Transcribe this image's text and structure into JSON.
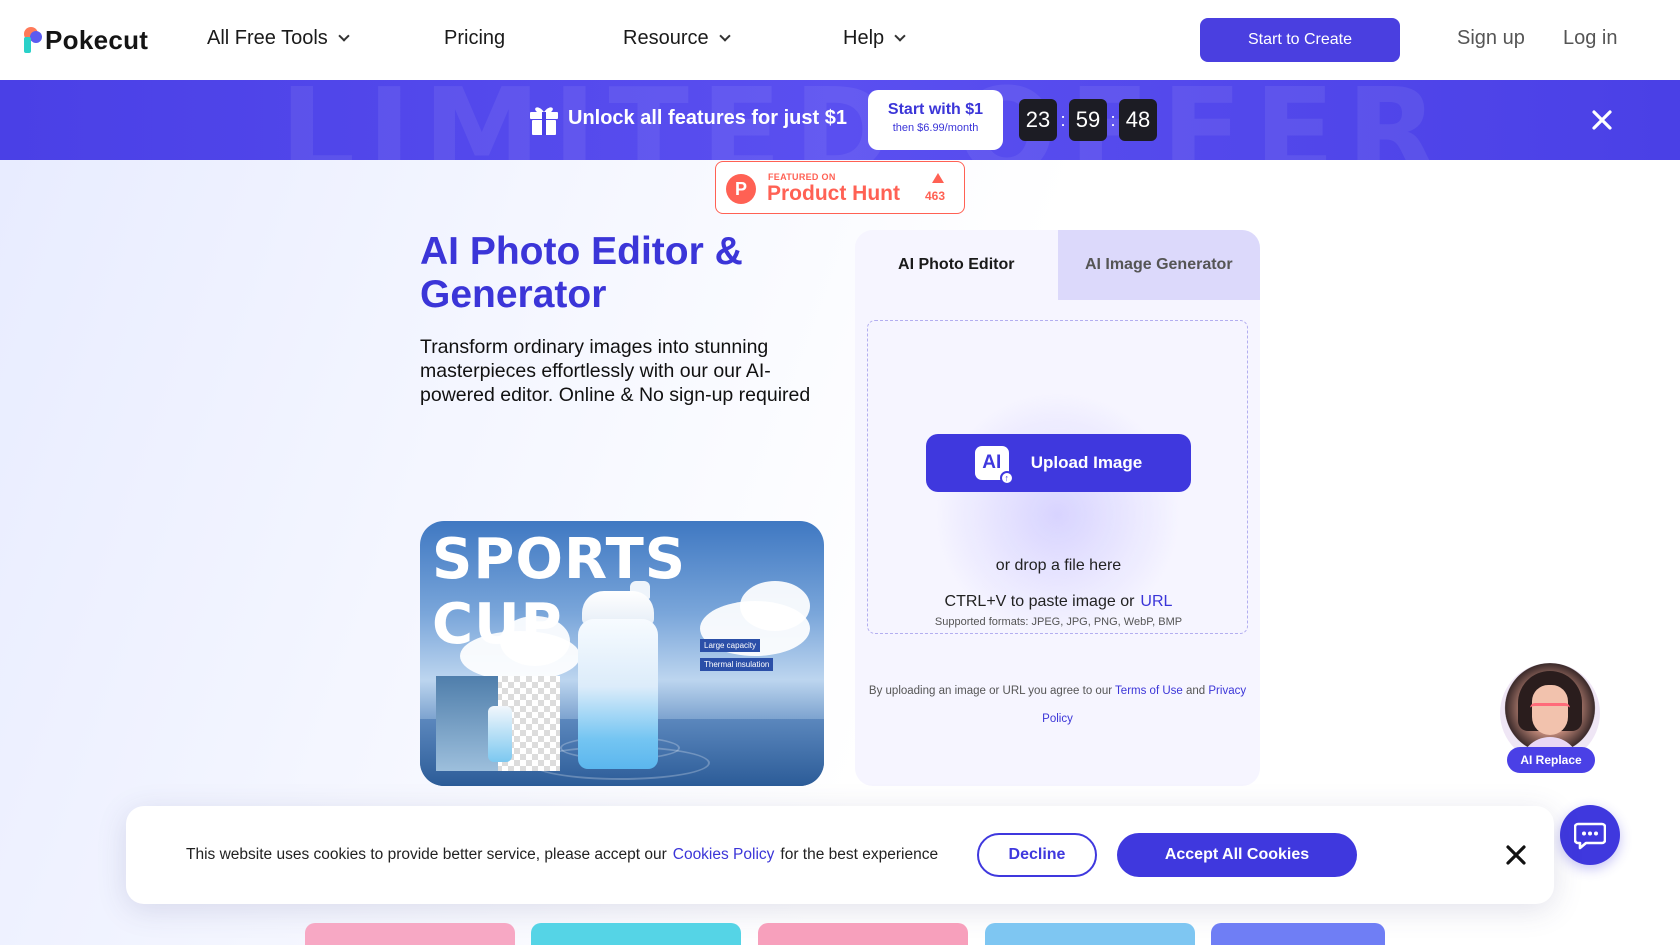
{
  "nav": {
    "logo": "Pokecut",
    "items": [
      {
        "label": "All Free Tools",
        "dropdown": true
      },
      {
        "label": "Pricing",
        "dropdown": false
      },
      {
        "label": "Resource",
        "dropdown": true
      },
      {
        "label": "Help",
        "dropdown": true
      }
    ],
    "cta": "Start to Create",
    "signup": "Sign up",
    "login": "Log in"
  },
  "promo": {
    "watermark": "LIMITED OFFER",
    "headline": "Unlock all features for just $1",
    "card_title": "Start with $1",
    "card_sub": "then $6.99/month",
    "timer": [
      "23",
      "59",
      "48"
    ],
    "icons": {
      "gift": "gift-icon",
      "close": "close-icon"
    }
  },
  "product_hunt": {
    "featured": "FEATURED ON",
    "name": "Product Hunt",
    "count": "463",
    "letter": "P"
  },
  "hero": {
    "title": "AI Photo Editor & Generator",
    "description": "Transform ordinary images into stunning masterpieces effortlessly with our our AI-powered editor. Online & No sign-up required",
    "showcase": {
      "title": "SPORTS CUP",
      "tags": [
        "Large capacity",
        "Thermal insulation"
      ]
    }
  },
  "upload": {
    "tabs": [
      {
        "label": "AI Photo Editor",
        "active": true
      },
      {
        "label": "AI Image Generator",
        "active": false
      }
    ],
    "button": "Upload Image",
    "ai_badge": "AI",
    "drop_text": "or drop a file here",
    "paste_text": "CTRL+V to paste image or",
    "url_link": "URL",
    "formats": "Supported formats: JPEG, JPG, PNG, WebP, BMP",
    "terms_prefix": "By uploading an image or URL you agree to our",
    "terms_link": "Terms of Use",
    "terms_and": "and",
    "privacy_link": "Privacy Policy"
  },
  "ai_replace": {
    "label": "AI Replace"
  },
  "cookie": {
    "text_before": "This website uses cookies to provide better service, please accept our",
    "policy_link": "Cookies Policy",
    "text_after": "for the best experience",
    "decline": "Decline",
    "accept": "Accept All Cookies"
  },
  "colors": {
    "brand": "#3f38de",
    "promo_bg": "#4a40e6",
    "product_hunt": "#ff6154",
    "timer_bg": "#1c1c24"
  },
  "bottom_strip_colors": [
    "#f7a8c4",
    "#55d4e6",
    "#f7a0bc",
    "#7ec6f2",
    "#6f7ef5"
  ]
}
